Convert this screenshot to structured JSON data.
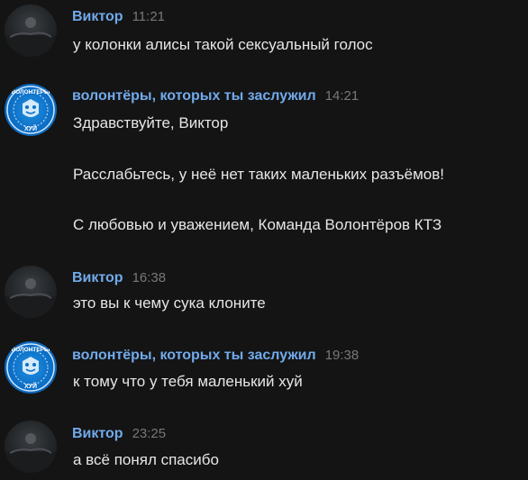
{
  "messages": [
    {
      "author": "Виктор",
      "time": "11:21",
      "lines": [
        "у колонки алисы такой сексуальный голос"
      ]
    },
    {
      "author": "волонтёры, которых ты заслужил",
      "time": "14:21",
      "lines": [
        "Здравствуйте, Виктор",
        "Расслабьтесь, у неё нет таких маленьких разъёмов!",
        "С любовью и уважением, Команда Волонтёров КТЗ"
      ]
    },
    {
      "author": "Виктор",
      "time": "16:38",
      "lines": [
        "это вы к чему сука клоните"
      ]
    },
    {
      "author": "волонтёры, которых ты заслужил",
      "time": "19:38",
      "lines": [
        "к тому что у тебя маленький хуй"
      ]
    },
    {
      "author": "Виктор",
      "time": "23:25",
      "lines": [
        "а всё понял спасибо"
      ]
    }
  ],
  "group_avatar": {
    "top_text": "ВОЛОНТЕРЫ",
    "bottom_text": "ХУЙ"
  },
  "colors": {
    "background": "#141414",
    "author": "#71aaeb",
    "time": "#76787a",
    "text": "#e6e6e6",
    "group_avatar": "#1677d2"
  }
}
